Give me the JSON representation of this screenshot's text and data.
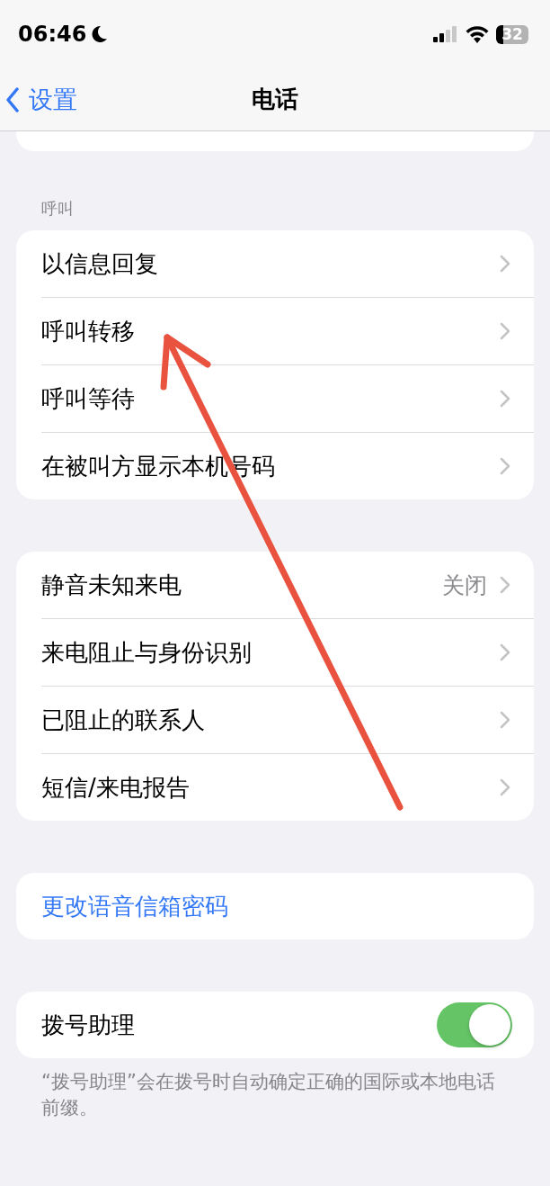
{
  "status_bar": {
    "time": "06:46",
    "focus_moon": true,
    "battery": "32"
  },
  "nav": {
    "back": "设置",
    "title": "电话"
  },
  "sections": [
    {
      "header": "呼叫",
      "rows": [
        {
          "kind": "link",
          "label": "以信息回复"
        },
        {
          "kind": "link",
          "label": "呼叫转移"
        },
        {
          "kind": "link",
          "label": "呼叫等待"
        },
        {
          "kind": "link",
          "label": "在被叫方显示本机号码"
        }
      ]
    },
    {
      "rows": [
        {
          "kind": "link",
          "label": "静音未知来电",
          "value": "关闭"
        },
        {
          "kind": "link",
          "label": "来电阻止与身份识别"
        },
        {
          "kind": "link",
          "label": "已阻止的联系人"
        },
        {
          "kind": "link",
          "label": "短信/来电报告"
        }
      ]
    },
    {
      "rows": [
        {
          "kind": "action",
          "label": "更改语音信箱密码"
        }
      ]
    },
    {
      "rows": [
        {
          "kind": "toggle",
          "label": "拨号助理",
          "on": true
        }
      ],
      "footer": "“拨号助理”会在拨号时自动确定正确的国际或本地电话前缀。"
    }
  ],
  "annotation": {
    "kind": "arrow"
  }
}
